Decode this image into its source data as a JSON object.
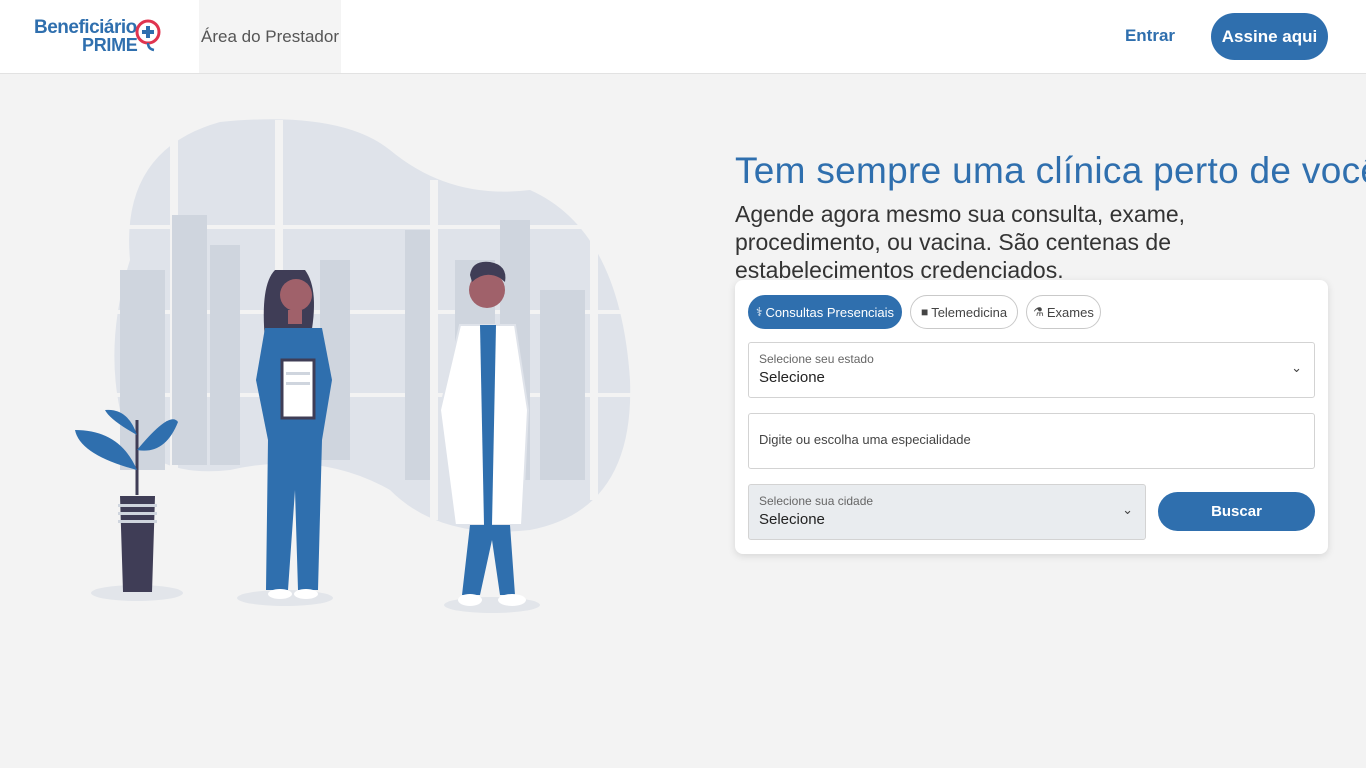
{
  "header": {
    "logo_top": "Beneficiário",
    "logo_bottom": "PRIME",
    "area_prestador": "Área do Prestador",
    "entrar": "Entrar",
    "assine": "Assine aqui"
  },
  "hero": {
    "title": "Tem sempre uma clínica perto de você!",
    "subtitle": "Agende agora mesmo sua consulta, exame, procedimento, ou vacina. São centenas de estabelecimentos credenciados."
  },
  "search": {
    "tabs": [
      {
        "label": "Consultas Presenciais",
        "icon": "stethoscope-icon",
        "active": true
      },
      {
        "label": "Telemedicina",
        "icon": "video-camera-icon",
        "active": false
      },
      {
        "label": "Exames",
        "icon": "microscope-icon",
        "active": false
      }
    ],
    "estado_label": "Selecione seu estado",
    "estado_value": "Selecione",
    "especialidade_placeholder": "Digite ou escolha uma especialidade",
    "cidade_label": "Selecione sua cidade",
    "cidade_value": "Selecione",
    "buscar": "Buscar"
  },
  "colors": {
    "brand": "#2f6fae",
    "accent_red": "#e0344f",
    "background": "#f3f3f3"
  }
}
